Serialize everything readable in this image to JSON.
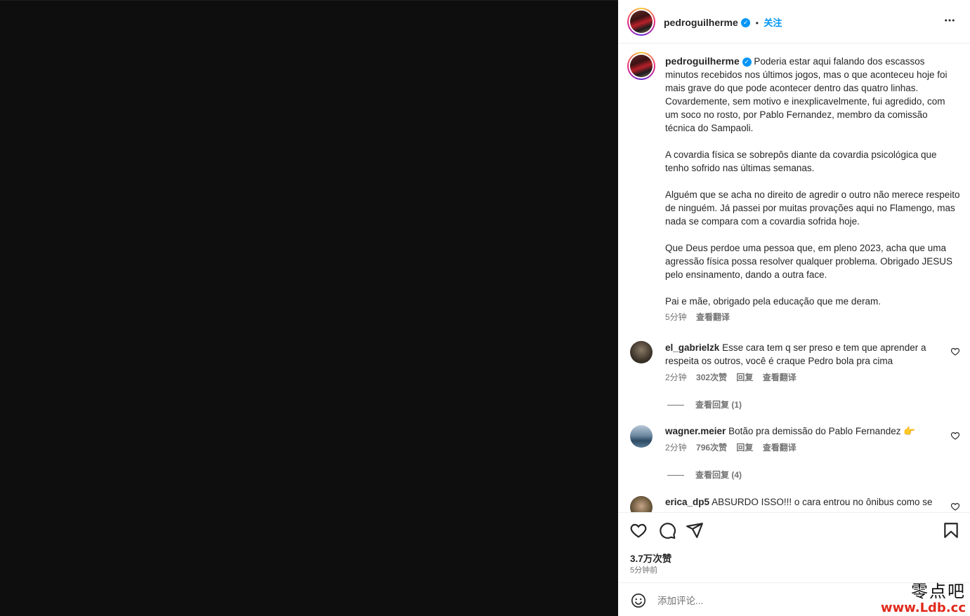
{
  "post": {
    "username": "pedroguilherme",
    "follow_label": "关注",
    "separator": "•",
    "more_label": "•••",
    "caption": {
      "paragraphs": [
        "Poderia estar aqui falando dos escassos minutos recebidos nos últimos jogos, mas o que aconteceu hoje foi mais grave do que pode acontecer dentro das quatro linhas. Covardemente, sem motivo e inexplicavelmente, fui agredido, com um soco no rosto, por Pablo Fernandez, membro da comissão técnica do Sampaoli.",
        "A covardia física se sobrepôs diante da covardia psicológica que tenho sofrido nas últimas semanas.",
        "Alguém que se acha no direito de agredir o outro não merece respeito de ninguém. Já passei por muitas provações aqui no Flamengo, mas nada se compara com a covardia sofrida hoje.",
        "Que Deus perdoe uma pessoa que, em pleno 2023, acha que uma agressão física possa resolver qualquer problema. Obrigado JESUS pelo ensinamento, dando a outra face.",
        "Pai e mãe, obrigado pela educação que me deram."
      ],
      "time": "5分钟",
      "translate_label": "查看翻译"
    }
  },
  "comments": [
    {
      "username": "el_gabrielzk",
      "text": "Esse cara tem q ser preso e tem que aprender a respeita os outros, você é craque Pedro bola pra cima",
      "time": "2分钟",
      "likes": "302次赞",
      "reply_label": "回复",
      "translate_label": "查看翻译",
      "view_replies": "查看回复 (1)"
    },
    {
      "username": "wagner.meier",
      "text": "Botão pra demissão do Pablo Fernandez 👉",
      "time": "2分钟",
      "likes": "796次赞",
      "reply_label": "回复",
      "translate_label": "查看翻译",
      "view_replies": "查看回复 (4)"
    },
    {
      "username": "erica_dp5",
      "text": "ABSURDO ISSO!!! o cara entrou no ônibus como se"
    }
  ],
  "footer": {
    "likes": "3.7万次赞",
    "time": "5分钟前",
    "comment_placeholder": "添加评论..."
  },
  "watermark": {
    "cn": "零点吧",
    "url": "www.Ldb.cc"
  },
  "colors": {
    "accent": "#0095f6",
    "text": "#262626",
    "secondary": "#737373",
    "media_bg": "#0e0e0e"
  }
}
